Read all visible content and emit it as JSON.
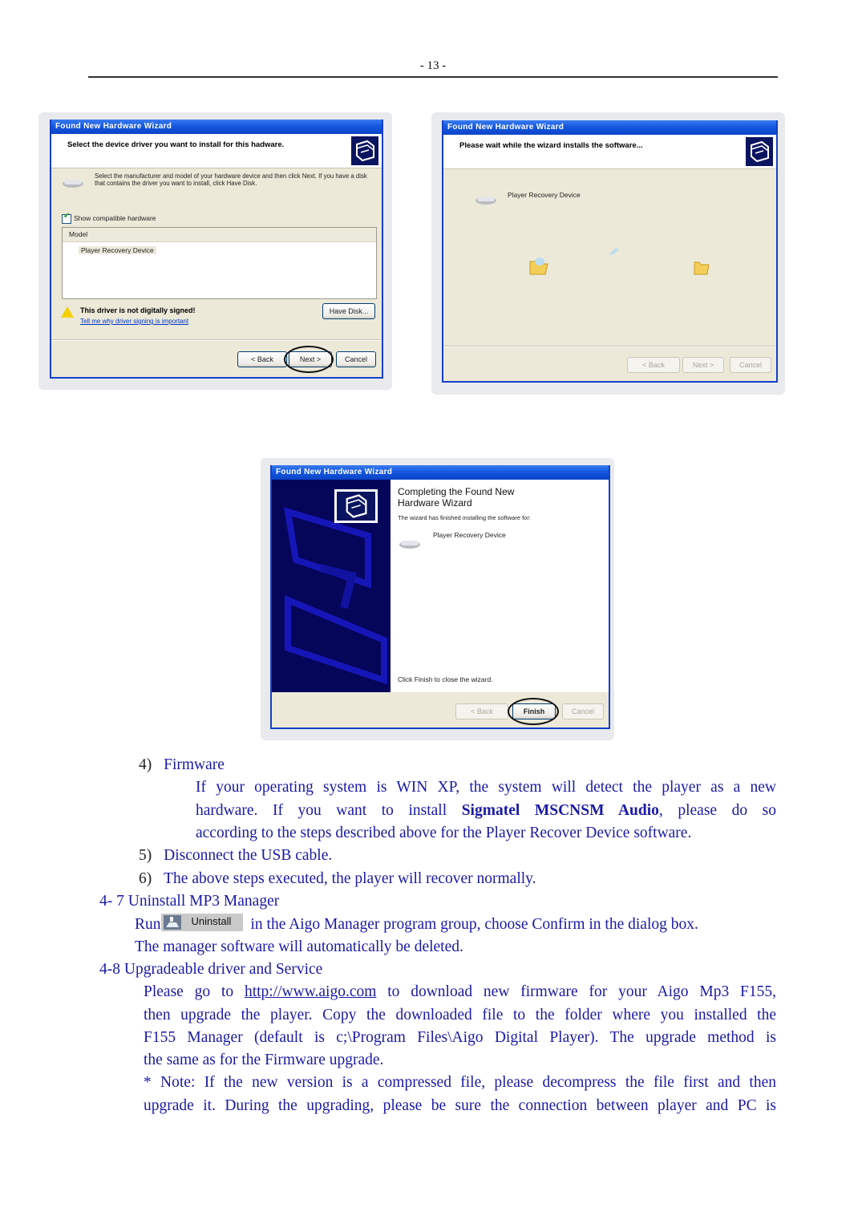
{
  "page": {
    "number": "- 13 -",
    "text_color": "#1a1aa6"
  },
  "dialog1": {
    "title": "Found New Hardware Wizard",
    "banner": "Select the device driver you want to install for this hadware.",
    "instruction": "Select the manufacturer and model of your hardware device and then click Next. If you have a disk that contains the driver you want to install, click Have Disk.",
    "checkbox_label": "Show compatible hardware",
    "checkbox_checked": true,
    "list_header": "Model",
    "list_items": [
      "Player Recovery Device"
    ],
    "warning": "This driver is not digitally signed!",
    "warning_link": "Tell me why driver signing is important",
    "have_disk": "Have Disk...",
    "back": "< Back",
    "next": "Next >",
    "cancel": "Cancel"
  },
  "dialog2": {
    "title": "Found New Hardware Wizard",
    "banner": "Please wait while the wizard installs the software...",
    "device": "Player Recovery Device",
    "back": "< Back",
    "next": "Next >",
    "cancel": "Cancel"
  },
  "dialog3": {
    "title": "Found New Hardware Wizard",
    "heading": "Completing the Found New Hardware Wizard",
    "finished_text": "The wizard has finished installing the software for:",
    "device": "Player Recovery Device",
    "close_hint": "Click Finish to close the wizard.",
    "back": "< Back",
    "finish": "Finish",
    "cancel": "Cancel"
  },
  "steps": [
    {
      "num": "4)",
      "label": "Firmware"
    },
    {
      "num": "5)",
      "label": "Disconnect the USB cable."
    },
    {
      "num": "6)",
      "label": "The above steps executed, the player will recover normally."
    }
  ],
  "firmware_para": {
    "line1": "If your operating system is WIN XP, the system will detect the player as a new",
    "line2_pre": "hardware. If you want to install ",
    "line2_bold": "Sigmatel MSCNSM Audio",
    "line2_post": ", please do so",
    "line3": "according to the steps described above for the Player Recover Device software."
  },
  "section47": {
    "heading": "4- 7 Uninstall MP3 Manager",
    "run": "Run",
    "button_label": "Uninstall",
    "after": "in the Aigo Manager program group, choose Confirm in the dialog box.",
    "line2": "The manager software will automatically be deleted."
  },
  "section48": {
    "heading": "4-8 Upgradeable driver and Service",
    "p1_pre": "Please go to ",
    "p1_link": "http://www.aigo.com",
    "p1_post": " to download new firmware for your Aigo Mp3 F155,",
    "p2": "then upgrade the player. Copy the downloaded file to the folder where you installed the",
    "p3": "F155 Manager (default is c;\\Program Files\\Aigo Digital Player). The upgrade method is",
    "p4": "the same as for the Firmware upgrade.",
    "n1": "* Note: If the new version is a compressed file, please decompress the file first and then",
    "n2": "upgrade it. During the upgrading, please be sure the connection between player and PC is"
  }
}
